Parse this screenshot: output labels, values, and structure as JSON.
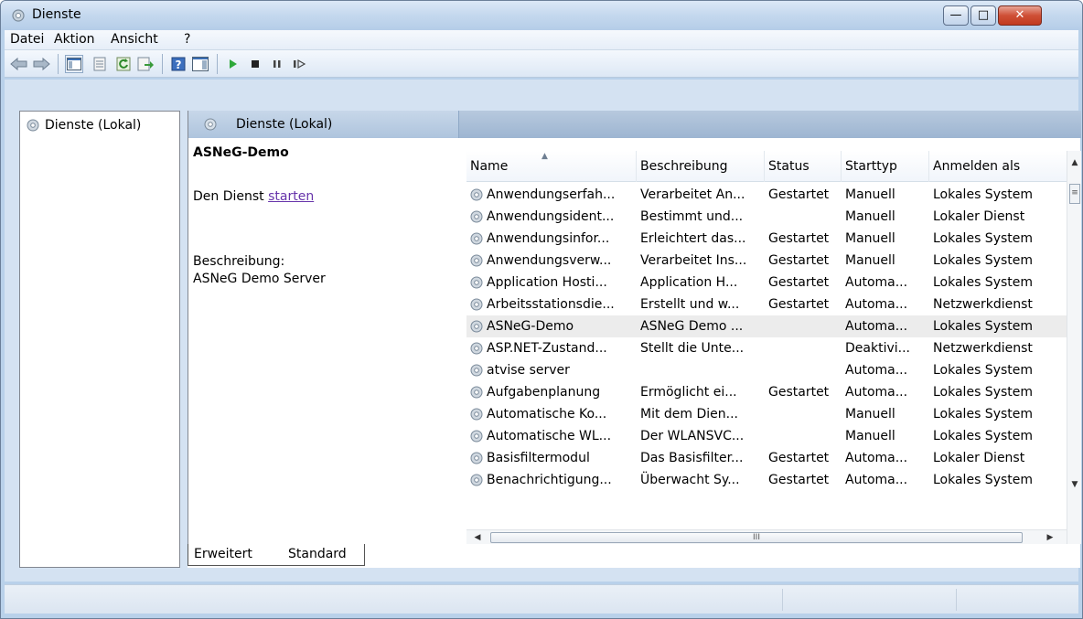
{
  "window": {
    "title": "Dienste"
  },
  "menu": {
    "items": [
      "Datei",
      "Aktion",
      "Ansicht",
      "?"
    ]
  },
  "toolbar": {
    "icons": [
      "back-icon",
      "forward-icon",
      "show-hide-console-tree-icon",
      "properties-icon",
      "refresh-icon",
      "export-list-icon",
      "help-icon",
      "show-action-pane-icon",
      "start-service-icon",
      "stop-service-icon",
      "pause-service-icon",
      "restart-service-icon"
    ]
  },
  "tree": {
    "root": "Dienste (Lokal)"
  },
  "pane": {
    "tab_label": "Dienste (Lokal)",
    "selected_service": "ASNeG-Demo",
    "action_prefix": "Den Dienst ",
    "action_link": "starten",
    "description_label": "Beschreibung:",
    "description_text": "ASNeG Demo Server"
  },
  "list": {
    "columns": [
      "Name",
      "Beschreibung",
      "Status",
      "Starttyp",
      "Anmelden als"
    ],
    "sorted_column": "Name",
    "rows": [
      {
        "name": "Anwendungserfah...",
        "description": "Verarbeitet An...",
        "status": "Gestartet",
        "start": "Manuell",
        "logon": "Lokales System"
      },
      {
        "name": "Anwendungsident...",
        "description": "Bestimmt und...",
        "status": "",
        "start": "Manuell",
        "logon": "Lokaler Dienst"
      },
      {
        "name": "Anwendungsinfor...",
        "description": "Erleichtert das...",
        "status": "Gestartet",
        "start": "Manuell",
        "logon": "Lokales System"
      },
      {
        "name": "Anwendungsverw...",
        "description": "Verarbeitet Ins...",
        "status": "Gestartet",
        "start": "Manuell",
        "logon": "Lokales System"
      },
      {
        "name": "Application Hosti...",
        "description": "Application H...",
        "status": "Gestartet",
        "start": "Automa...",
        "logon": "Lokales System"
      },
      {
        "name": "Arbeitsstationsdie...",
        "description": "Erstellt und w...",
        "status": "Gestartet",
        "start": "Automa...",
        "logon": "Netzwerkdienst"
      },
      {
        "name": "ASNeG-Demo",
        "description": "ASNeG Demo ...",
        "status": "",
        "start": "Automa...",
        "logon": "Lokales System",
        "selected": true
      },
      {
        "name": "ASP.NET-Zustand...",
        "description": "Stellt die Unte...",
        "status": "",
        "start": "Deaktivi...",
        "logon": "Netzwerkdienst"
      },
      {
        "name": "atvise server",
        "description": "",
        "status": "",
        "start": "Automa...",
        "logon": "Lokales System"
      },
      {
        "name": "Aufgabenplanung",
        "description": "Ermöglicht ei...",
        "status": "Gestartet",
        "start": "Automa...",
        "logon": "Lokales System"
      },
      {
        "name": "Automatische Ko...",
        "description": "Mit dem Dien...",
        "status": "",
        "start": "Manuell",
        "logon": "Lokales System"
      },
      {
        "name": "Automatische WL...",
        "description": "Der WLANSVC...",
        "status": "",
        "start": "Manuell",
        "logon": "Lokales System"
      },
      {
        "name": "Basisfiltermodul",
        "description": "Das Basisfilter...",
        "status": "Gestartet",
        "start": "Automa...",
        "logon": "Lokaler Dienst"
      },
      {
        "name": "Benachrichtigung...",
        "description": "Überwacht Sy...",
        "status": "Gestartet",
        "start": "Automa...",
        "logon": "Lokales System"
      }
    ]
  },
  "bottom_tabs": {
    "extended": "Erweitert",
    "standard": "Standard"
  },
  "scrollbar": {
    "hthumb_glyph": "III"
  }
}
